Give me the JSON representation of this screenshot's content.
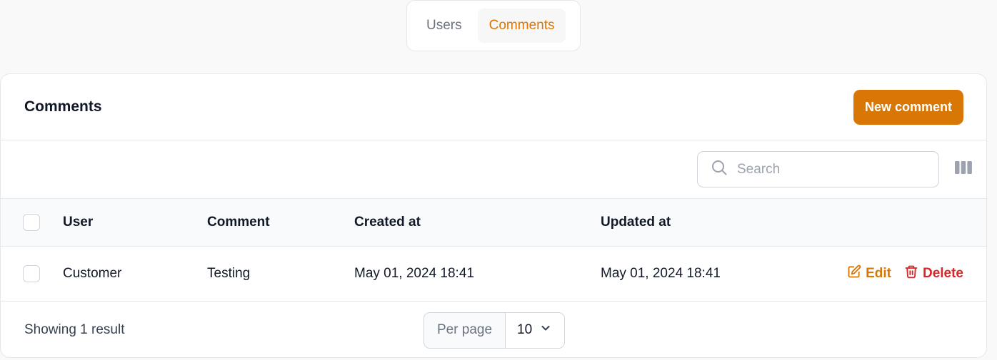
{
  "tabs": [
    {
      "label": "Users",
      "active": false
    },
    {
      "label": "Comments",
      "active": true
    }
  ],
  "card": {
    "title": "Comments",
    "new_button_label": "New comment"
  },
  "search": {
    "placeholder": "Search",
    "value": ""
  },
  "table": {
    "columns": [
      "User",
      "Comment",
      "Created at",
      "Updated at"
    ],
    "rows": [
      {
        "user": "Customer",
        "comment": "Testing",
        "created_at": "May 01, 2024 18:41",
        "updated_at": "May 01, 2024 18:41",
        "edit_label": "Edit",
        "delete_label": "Delete"
      }
    ]
  },
  "footer": {
    "showing_text": "Showing 1 result",
    "per_page_label": "Per page",
    "per_page_value": "10"
  },
  "colors": {
    "accent": "#d97706",
    "danger": "#dc2626"
  },
  "icons": {
    "search": "search-icon",
    "columns": "columns-icon",
    "edit": "pencil-square-icon",
    "delete": "trash-icon",
    "select": "chevron-down-icon"
  }
}
